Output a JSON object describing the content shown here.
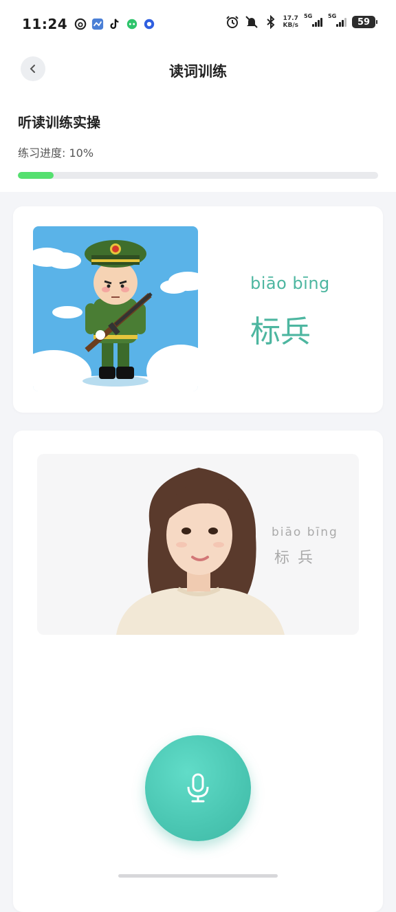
{
  "status_bar": {
    "time": "11:24",
    "net_speed_value": "17.7",
    "net_speed_unit": "KB/s",
    "signal1_label": "5G",
    "signal2_label": "5G",
    "battery": "59"
  },
  "header": {
    "title": "读词训练",
    "back_icon": "chevron-left-icon"
  },
  "section": {
    "title": "听读训练实操",
    "progress_label": "练习进度: 10%",
    "progress_value": 0.1
  },
  "word_card": {
    "pinyin": "biāo bīng",
    "hanzi": "标兵",
    "image": "soldier-illustration"
  },
  "video_card": {
    "pinyin": "biāo  bīng",
    "hanzi": "标兵",
    "image": "presenter-video"
  },
  "controls": {
    "mic_icon": "microphone-icon"
  },
  "colors": {
    "accent": "#4db6a0",
    "progress": "#55e06f",
    "mic": "#4ac6b2"
  }
}
